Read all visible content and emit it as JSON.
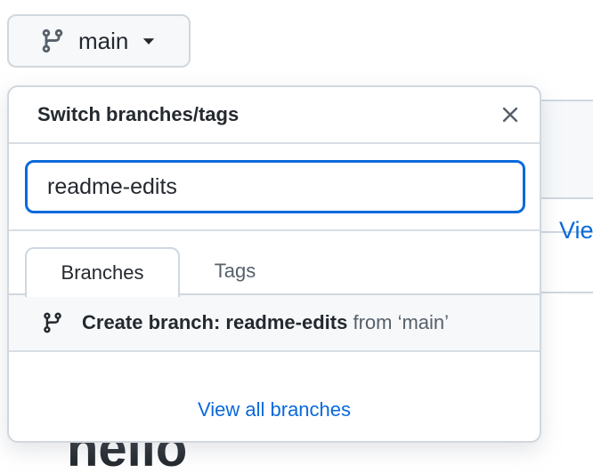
{
  "branch_button": {
    "label": "main",
    "icon": "git-branch-icon",
    "caret_icon": "triangle-down-icon"
  },
  "dropdown": {
    "title": "Switch branches/tags",
    "close_icon": "x-icon",
    "search": {
      "value": "readme-edits",
      "focus_color": "#0969da"
    },
    "tabs": [
      {
        "label": "Branches",
        "selected": true
      },
      {
        "label": "Tags",
        "selected": false
      }
    ],
    "create_branch": {
      "icon": "git-branch-icon",
      "prefix": "Create branch: ",
      "branch_name": "readme-edits",
      "from_text": " from ‘main’"
    },
    "view_all": "View all branches"
  },
  "background": {
    "link_fragment": "Vie",
    "heading_fragment": "hello"
  },
  "colors": {
    "accent": "#0969da",
    "border": "#d0d7de",
    "muted_text": "#57606a"
  }
}
